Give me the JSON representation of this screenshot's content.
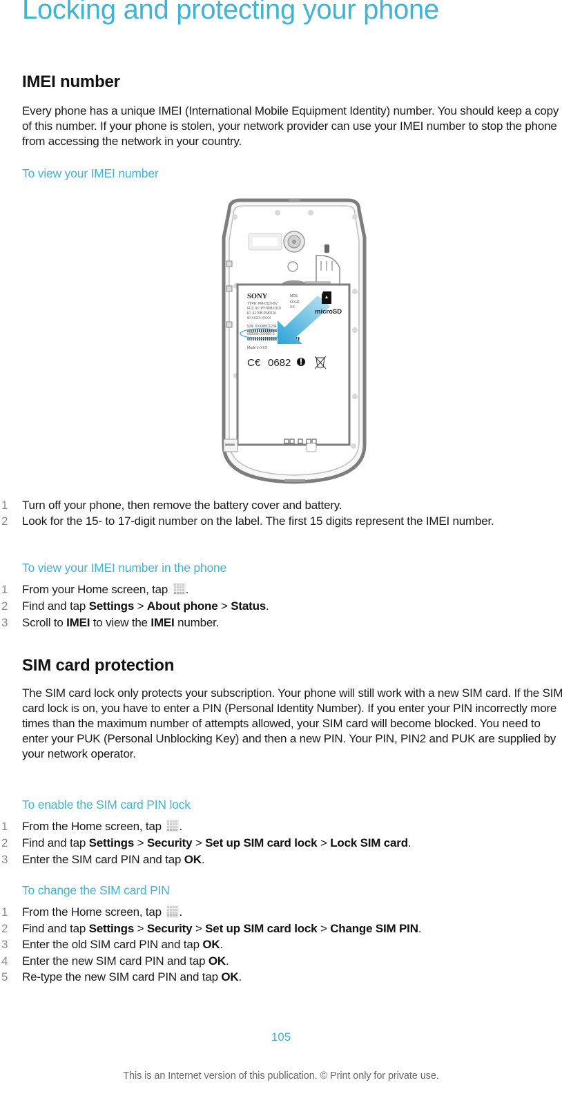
{
  "page": {
    "title": "Locking and protecting your phone",
    "page_number": "105",
    "footer_note": "This is an Internet version of this publication. © Print only for private use.",
    "accent_color": "#3fb3d5"
  },
  "imei": {
    "heading": "IMEI number",
    "intro": "Every phone has a unique IMEI (International Mobile Equipment Identity) number. You should keep a copy of this number. If your phone is stolen, your network provider can use your IMEI number to stop the phone from accessing the network in your country.",
    "view": {
      "heading": "To view your IMEI number",
      "steps": [
        {
          "num": "1",
          "text": "Turn off your phone, then remove the battery cover and battery."
        },
        {
          "num": "2",
          "text": "Look for the 15- to 17-digit number on the label. The first 15 digits represent the IMEI number."
        }
      ]
    },
    "illustration": {
      "brand": "SONY",
      "label_lines": [
        "TYPE: PM-0110-BV",
        "FCC ID: PY7PM-0110",
        "IC: 4170B-PM0110",
        "SI XXXX-XXXX",
        "S/N: XXXABC1234"
      ],
      "label_right": [
        "MDS",
        "FFGR",
        "XX"
      ],
      "imei_digits": "000000-000000-0",
      "made_in": "Made in XXX",
      "ce_mark": "0682",
      "card_label": "microSD",
      "icons": [
        "arrow-icon",
        "alert-icon",
        "weee-bin-icon",
        "microsd-icon"
      ]
    },
    "in_phone": {
      "heading": "To view your IMEI number in the phone",
      "steps": [
        {
          "num": "1",
          "parts": [
            {
              "t": "From your Home screen, tap "
            },
            {
              "icon": "application-grid-icon"
            },
            {
              "t": "."
            }
          ]
        },
        {
          "num": "2",
          "parts": [
            {
              "t": "Find and tap "
            },
            {
              "b": "Settings"
            },
            {
              "t": " > "
            },
            {
              "b": "About phone"
            },
            {
              "t": " > "
            },
            {
              "b": "Status"
            },
            {
              "t": "."
            }
          ]
        },
        {
          "num": "3",
          "parts": [
            {
              "t": "Scroll to "
            },
            {
              "b": "IMEI"
            },
            {
              "t": " to view the "
            },
            {
              "b": "IMEI"
            },
            {
              "t": " number."
            }
          ]
        }
      ]
    }
  },
  "sim": {
    "heading": "SIM card protection",
    "intro": "The SIM card lock only protects your subscription. Your phone will still work with a new SIM card. If the SIM card lock is on, you have to enter a PIN (Personal Identity Number). If you enter your PIN incorrectly more times than the maximum number of attempts allowed, your SIM card will become blocked. You need to enter your PUK (Personal Unblocking Key) and then a new PIN. Your PIN, PIN2 and PUK are supplied by your network operator.",
    "enable": {
      "heading": "To enable the SIM card PIN lock",
      "steps": [
        {
          "num": "1",
          "parts": [
            {
              "t": "From the Home screen, tap "
            },
            {
              "icon": "application-grid-icon"
            },
            {
              "t": "."
            }
          ]
        },
        {
          "num": "2",
          "parts": [
            {
              "t": "Find and tap "
            },
            {
              "b": "Settings"
            },
            {
              "t": " > "
            },
            {
              "b": "Security"
            },
            {
              "t": " > "
            },
            {
              "b": "Set up SIM card lock"
            },
            {
              "t": " > "
            },
            {
              "b": "Lock SIM card"
            },
            {
              "t": "."
            }
          ]
        },
        {
          "num": "3",
          "parts": [
            {
              "t": "Enter the SIM card PIN and tap "
            },
            {
              "b": "OK"
            },
            {
              "t": "."
            }
          ]
        }
      ]
    },
    "change": {
      "heading": "To change the SIM card PIN",
      "steps": [
        {
          "num": "1",
          "parts": [
            {
              "t": "From the Home screen, tap "
            },
            {
              "icon": "application-grid-icon"
            },
            {
              "t": "."
            }
          ]
        },
        {
          "num": "2",
          "parts": [
            {
              "t": "Find and tap "
            },
            {
              "b": "Settings"
            },
            {
              "t": " > "
            },
            {
              "b": "Security"
            },
            {
              "t": " > "
            },
            {
              "b": "Set up SIM card lock"
            },
            {
              "t": " > "
            },
            {
              "b": "Change SIM PIN"
            },
            {
              "t": "."
            }
          ]
        },
        {
          "num": "3",
          "parts": [
            {
              "t": "Enter the old SIM card PIN and tap "
            },
            {
              "b": "OK"
            },
            {
              "t": "."
            }
          ]
        },
        {
          "num": "4",
          "parts": [
            {
              "t": "Enter the new SIM card PIN and tap "
            },
            {
              "b": "OK"
            },
            {
              "t": "."
            }
          ]
        },
        {
          "num": "5",
          "parts": [
            {
              "t": "Re-type the new SIM card PIN and tap "
            },
            {
              "b": "OK"
            },
            {
              "t": "."
            }
          ]
        }
      ]
    }
  }
}
